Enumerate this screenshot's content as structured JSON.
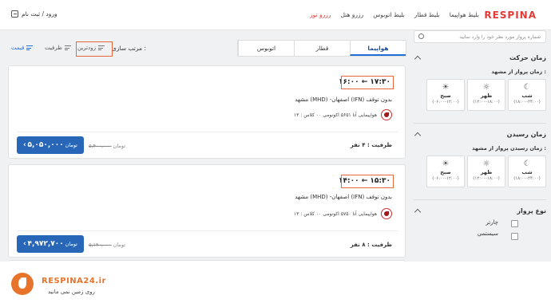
{
  "header": {
    "brand": "RESPINA",
    "nav": [
      "بلیط هواپیما",
      "بلیط قطار",
      "بلیط اتوبوس",
      "رزرو هتل",
      "رزرو تور"
    ],
    "active_nav": "رزرو تور",
    "login": "ورود / ثبت نام"
  },
  "sidebar": {
    "search_placeholder": "شماره پرواز مورد نظر خود را وارد نمایید",
    "departure": {
      "title": "زمان حرکت",
      "sub": "زمان پرواز از مشهد :",
      "tiles": [
        {
          "label": "شب",
          "range": "(۱۸:۰۰-۲۴:۰۰)",
          "icon": "moon-icon",
          "glyph": "☾"
        },
        {
          "label": "ظهر",
          "range": "(۱۲:۰۰-۱۸:۰۰)",
          "icon": "sun-cloud-icon",
          "glyph": "☼"
        },
        {
          "label": "صبح",
          "range": "(۰۶:۰۰-۱۲:۰۰)",
          "icon": "sun-icon",
          "glyph": "☀"
        }
      ]
    },
    "arrival": {
      "title": "زمان رسیدن",
      "sub": "زمان رسیدن پرواز از مشهد :",
      "tiles": [
        {
          "label": "شب",
          "range": "(۱۸:۰۰-۲۴:۰۰)",
          "icon": "moon-icon",
          "glyph": "☾"
        },
        {
          "label": "ظهر",
          "range": "(۱۲:۰۰-۱۸:۰۰)",
          "icon": "sun-cloud-icon",
          "glyph": "☼"
        },
        {
          "label": "صبح",
          "range": "(۰۶:۰۰-۱۲:۰۰)",
          "icon": "sun-icon",
          "glyph": "☀"
        }
      ]
    },
    "flight_type": {
      "title": "نوع پرواز",
      "options": [
        "چارتر",
        "سیستمی"
      ]
    }
  },
  "sort": {
    "label": "مرتب سازی :",
    "options": [
      "زودترین",
      "ظرفیت",
      "قیمت"
    ]
  },
  "tabs": [
    "هواپیما",
    "قطار",
    "اتوبوس"
  ],
  "flights": [
    {
      "time": "۱۶:۰۰ ← ۱۷:۳۰",
      "route": "مشهد (MHD) -اصفهان (IFN)   بدون توقف",
      "airline": "هواپیمایی آتا  ۵۶۵۱   اکونومی ۰۰ کلاس : ۱۳",
      "capacity": "ظرفیت : ۴ نفر",
      "price": "۵,۰۵۰,۰۰۰",
      "currency": "تومان",
      "old_price": "۵,۴۰۰,۰۰۰",
      "old_currency": "تومان"
    },
    {
      "time": "۱۴:۰۰ ← ۱۵:۳۰",
      "route": "مشهد (MHD) -اصفهان (IFN)   بدون توقف",
      "airline": "هواپیمایی آتا  ۵۷۵۰   اکونومی ۰۰ کلاس : ۱۳",
      "capacity": "ظرفیت : ۸ نفر",
      "price": "۴,۹۷۲,۷۰۰",
      "currency": "تومان",
      "old_price": "۵,۱۴۰,۰۰۰",
      "old_currency": "تومان"
    }
  ],
  "watermark": {
    "name": "RESPINA24.ir",
    "tagline": "روی زمین نمی مانید"
  },
  "colors": {
    "brand_red": "#e53935",
    "primary_blue": "#2866b8",
    "highlight_orange": "#e8663c"
  }
}
